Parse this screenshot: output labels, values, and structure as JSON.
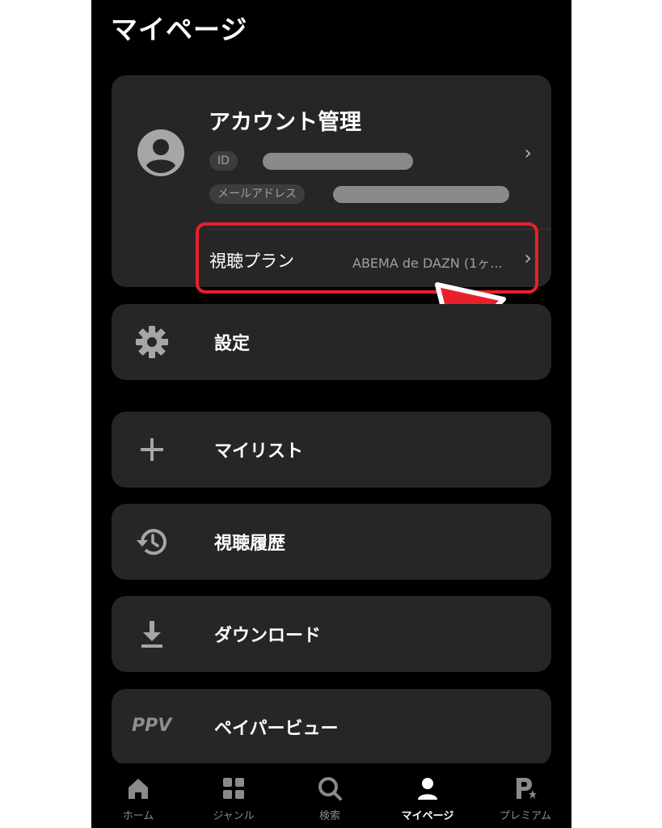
{
  "header": {
    "title": "マイページ"
  },
  "account": {
    "title": "アカウント管理",
    "id_label": "ID",
    "email_label": "メールアドレス",
    "plan_label": "視聴プラン",
    "plan_value": "ABEMA de DAZN (1ヶ..."
  },
  "menu": {
    "settings": "設定",
    "mylist": "マイリスト",
    "history": "視聴履歴",
    "download": "ダウンロード",
    "ppv_badge": "PPV",
    "ppv": "ペイパービュー"
  },
  "nav": {
    "home": "ホーム",
    "genre": "ジャンル",
    "search": "検索",
    "mypage": "マイページ",
    "premium": "プレミアム"
  },
  "colors": {
    "highlight": "#e8202c",
    "card": "#262626",
    "background": "#000000"
  },
  "icons": [
    "avatar-icon",
    "gear-icon",
    "plus-icon",
    "history-icon",
    "download-icon",
    "home-icon",
    "grid-icon",
    "search-icon",
    "person-icon",
    "premium-icon"
  ]
}
